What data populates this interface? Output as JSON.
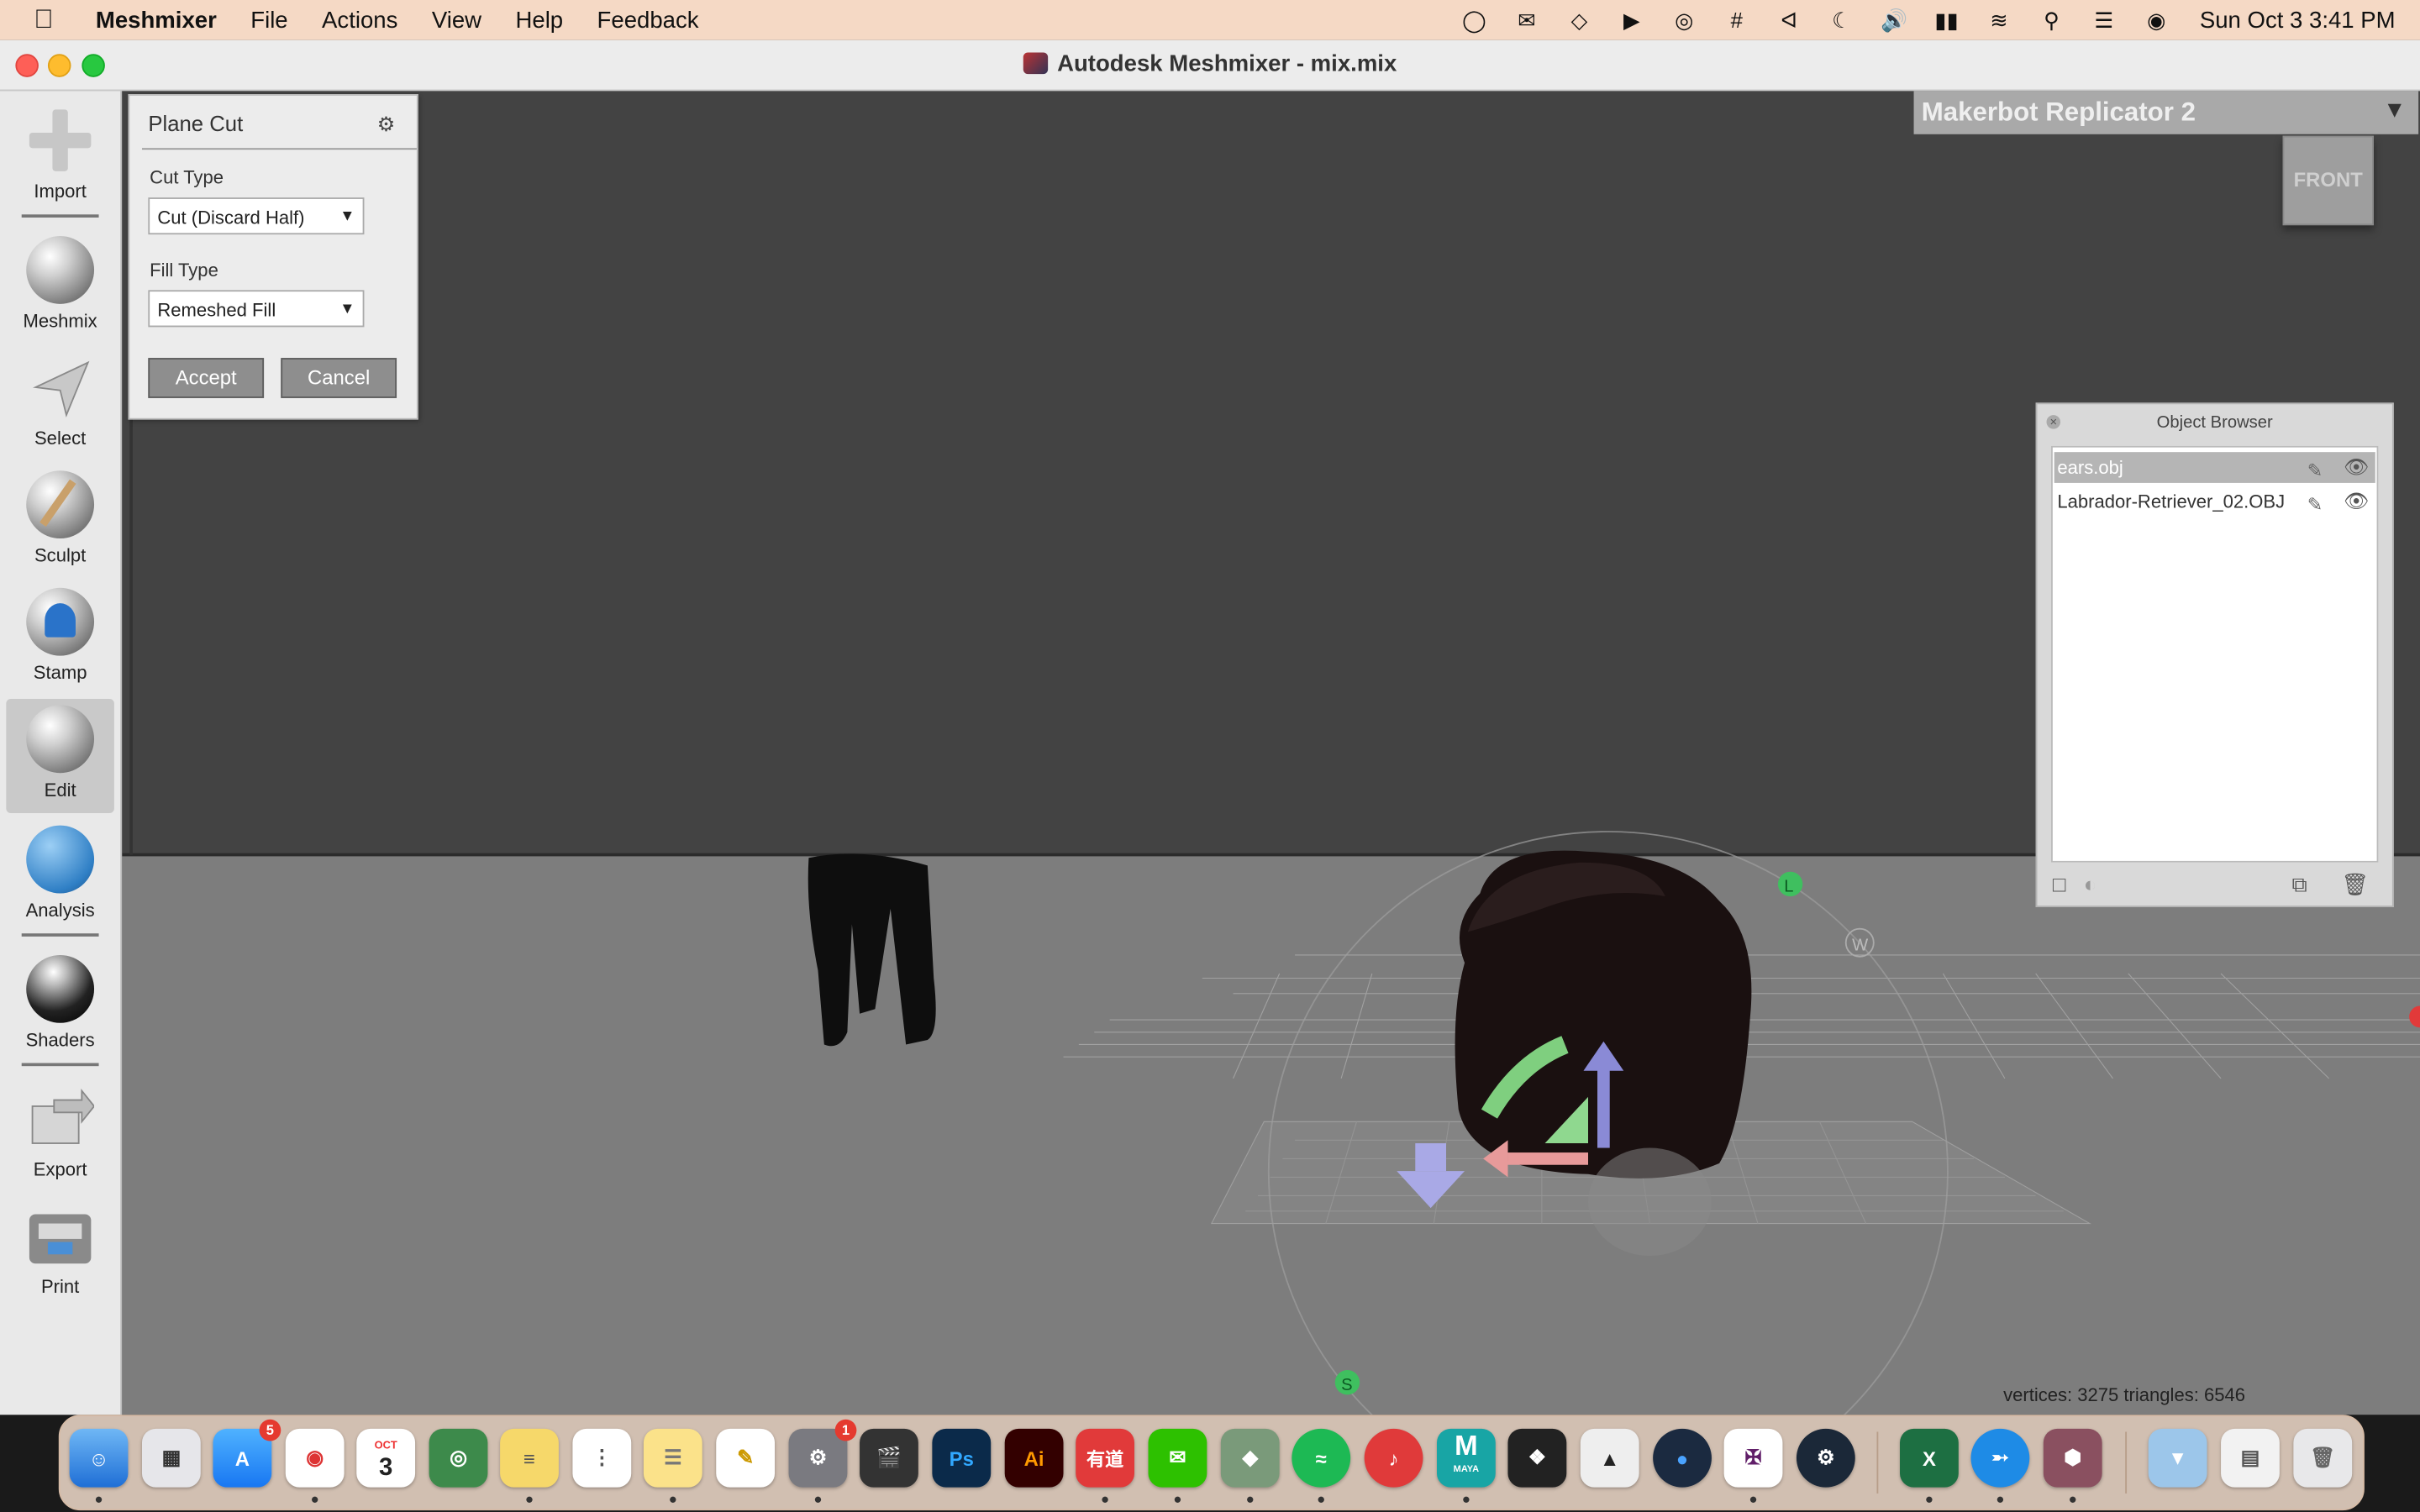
{
  "menubar": {
    "app_name": "Meshmixer",
    "items": [
      "File",
      "Actions",
      "View",
      "Help",
      "Feedback"
    ],
    "clock": "Sun Oct 3  3:41 PM"
  },
  "window": {
    "title": "Autodesk Meshmixer - mix.mix"
  },
  "toolbar": {
    "tools": [
      {
        "label": "Import"
      },
      {
        "label": "Meshmix"
      },
      {
        "label": "Select"
      },
      {
        "label": "Sculpt"
      },
      {
        "label": "Stamp"
      },
      {
        "label": "Edit"
      },
      {
        "label": "Analysis"
      },
      {
        "label": "Shaders"
      },
      {
        "label": "Export"
      },
      {
        "label": "Print"
      }
    ]
  },
  "plane_cut": {
    "title": "Plane Cut",
    "cut_type_label": "Cut Type",
    "cut_type_value": "Cut (Discard Half)",
    "fill_type_label": "Fill Type",
    "fill_type_value": "Remeshed Fill",
    "accept": "Accept",
    "cancel": "Cancel"
  },
  "printer": {
    "name": "Makerbot Replicator 2"
  },
  "viewcube": {
    "face": "FRONT"
  },
  "object_browser": {
    "title": "Object Browser",
    "items": [
      {
        "name": "ears.obj",
        "selected": true
      },
      {
        "name": "Labrador-Retriever_02.OBJ",
        "selected": false
      }
    ]
  },
  "gizmo": {
    "labels": [
      "L",
      "W",
      "S"
    ]
  },
  "status": {
    "text": "vertices: 3275 triangles: 6546"
  },
  "dock": {
    "badges": {
      "app_store": "5",
      "system_prefs": "1"
    },
    "calendar": {
      "month": "OCT",
      "day": "3"
    },
    "labels": {
      "photoshop": "Ps",
      "illustrator": "Ai",
      "youdao": "有道",
      "maya": "MAYA"
    }
  }
}
